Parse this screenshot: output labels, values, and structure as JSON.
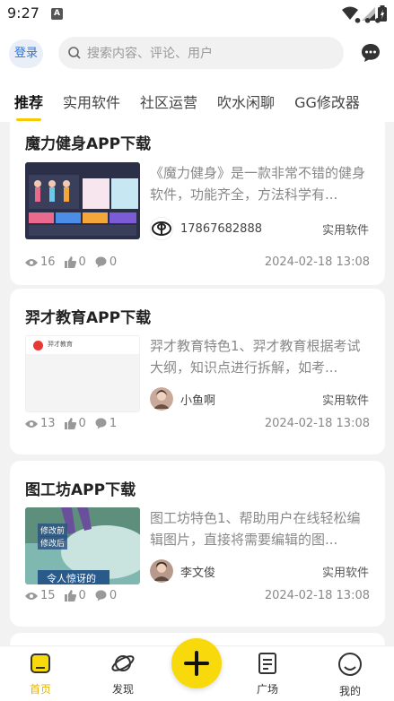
{
  "status_bar": {
    "time": "9:27",
    "app_icon_letter": "A"
  },
  "header": {
    "login_label": "登录",
    "search_placeholder": "搜索内容、评论、用户"
  },
  "tabs": [
    {
      "label": "推荐",
      "active": true
    },
    {
      "label": "实用软件"
    },
    {
      "label": "社区运营"
    },
    {
      "label": "吹水闲聊"
    },
    {
      "label": "GG修改器"
    }
  ],
  "tabs_more": "•••",
  "posts": [
    {
      "title": "魔力健身APP下载",
      "excerpt": "《魔力健身》是一款非常不错的健身软件，功能齐全，方法科学有...",
      "author": "17867682888",
      "category": "实用软件",
      "views": "16",
      "likes": "0",
      "comments": "0",
      "date": "2024-02-18 13:08"
    },
    {
      "title": "羿才教育APP下载",
      "excerpt": "羿才教育特色1、羿才教育根据考试大纲，知识点进行拆解，如考...",
      "author": "小鱼啊",
      "category": "实用软件",
      "views": "13",
      "likes": "0",
      "comments": "1",
      "date": "2024-02-18 13:08",
      "thumb_text": "羿才教育"
    },
    {
      "title": "图工坊APP下载",
      "excerpt": "图工坊特色1、帮助用户在线轻松编辑图片，直接将需要编辑的图...",
      "author": "李文俊",
      "category": "实用软件",
      "views": "15",
      "likes": "0",
      "comments": "0",
      "date": "2024-02-18 13:08",
      "thumb_labels": [
        "修改前",
        "修改后",
        "令人惊讶的"
      ]
    }
  ],
  "bottom_nav": [
    {
      "label": "首页",
      "icon": "home-icon",
      "active": true
    },
    {
      "label": "发现",
      "icon": "planet-icon"
    },
    {
      "label": "广场",
      "icon": "document-icon"
    },
    {
      "label": "我的",
      "icon": "smile-icon"
    }
  ],
  "colors": {
    "accent": "#f7d90c",
    "active_tab_underline": "#f7c900",
    "login_text": "#2f74d6"
  }
}
